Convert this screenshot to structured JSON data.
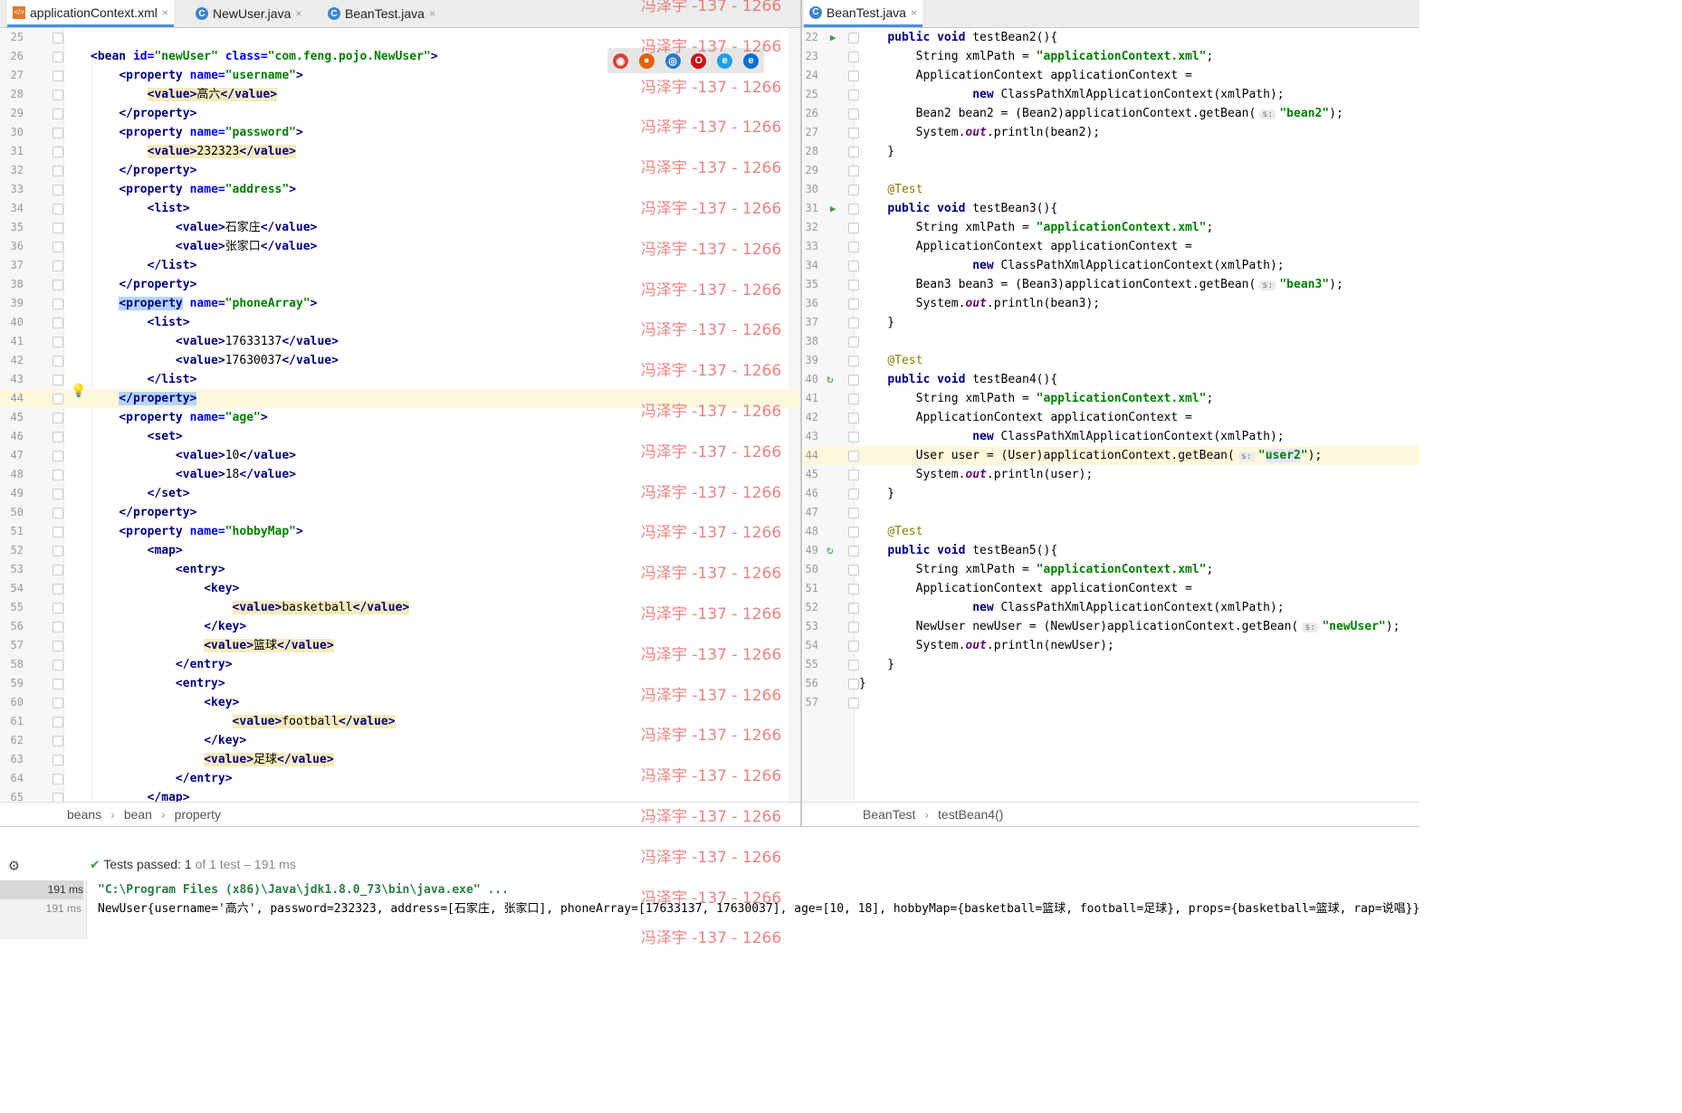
{
  "left_tabs": [
    {
      "label": "applicationContext.xml",
      "icon": "xml-file-icon",
      "active": true
    },
    {
      "label": "NewUser.java",
      "icon": "class-file-icon",
      "active": false
    },
    {
      "label": "BeanTest.java",
      "icon": "test-class-file-icon",
      "active": false
    }
  ],
  "right_tabs": [
    {
      "label": "BeanTest.java",
      "icon": "test-class-file-icon",
      "active": true
    }
  ],
  "close_glyph": "×",
  "watermark": "冯泽宇 -137 - 1266",
  "xml_lines": [
    {
      "n": "25",
      "html": ""
    },
    {
      "n": "26",
      "html": "<span class=\"tag\">&lt;bean </span><span class=\"at\">id=</span><span class=\"av\">\"newUser\"</span> <span class=\"at\">class=</span><span class=\"av\">\"com.feng.pojo.NewUser\"</span><span class=\"tag\">&gt;</span>"
    },
    {
      "n": "27",
      "html": "    <span class=\"tag\">&lt;property </span><span class=\"at\">name=</span><span class=\"av\">\"username\"</span><span class=\"tag\">&gt;</span>"
    },
    {
      "n": "28",
      "html": "        <span class=\"hl\"><span class=\"tag\">&lt;value&gt;</span>高六<span class=\"tag\">&lt;/value&gt;</span></span>"
    },
    {
      "n": "29",
      "html": "    <span class=\"tag\">&lt;/property&gt;</span>"
    },
    {
      "n": "30",
      "html": "    <span class=\"tag\">&lt;property </span><span class=\"at\">name=</span><span class=\"av\">\"password\"</span><span class=\"tag\">&gt;</span>"
    },
    {
      "n": "31",
      "html": "        <span class=\"hl\"><span class=\"tag\">&lt;value&gt;</span>232323<span class=\"tag\">&lt;/value&gt;</span></span>"
    },
    {
      "n": "32",
      "html": "    <span class=\"tag\">&lt;/property&gt;</span>"
    },
    {
      "n": "33",
      "html": "    <span class=\"tag\">&lt;property </span><span class=\"at\">name=</span><span class=\"av\">\"address\"</span><span class=\"tag\">&gt;</span>"
    },
    {
      "n": "34",
      "html": "        <span class=\"tag\">&lt;list&gt;</span>"
    },
    {
      "n": "35",
      "html": "            <span class=\"tag\">&lt;value&gt;</span>石家庄<span class=\"tag\">&lt;/value&gt;</span>"
    },
    {
      "n": "36",
      "html": "            <span class=\"tag\">&lt;value&gt;</span>张家口<span class=\"tag\">&lt;/value&gt;</span>"
    },
    {
      "n": "37",
      "html": "        <span class=\"tag\">&lt;/list&gt;</span>"
    },
    {
      "n": "38",
      "html": "    <span class=\"tag\">&lt;/property&gt;</span>"
    },
    {
      "n": "39",
      "html": "    <span class=\"hlsel\"><span class=\"tag\">&lt;property</span></span> <span class=\"at\">name=</span><span class=\"av\">\"phoneArray\"</span><span class=\"tag\">&gt;</span>"
    },
    {
      "n": "40",
      "html": "        <span class=\"tag\">&lt;list&gt;</span>"
    },
    {
      "n": "41",
      "html": "            <span class=\"tag\">&lt;value&gt;</span>17633137<span class=\"tag\">&lt;/value&gt;</span>"
    },
    {
      "n": "42",
      "html": "            <span class=\"tag\">&lt;value&gt;</span>17630037<span class=\"tag\">&lt;/value&gt;</span>"
    },
    {
      "n": "43",
      "html": "        <span class=\"tag\">&lt;/list&gt;</span>"
    },
    {
      "n": "44",
      "html": "    <span class=\"hlsel\"><span class=\"tag\">&lt;/property&gt;</span></span>",
      "cur": true
    },
    {
      "n": "45",
      "html": "    <span class=\"tag\">&lt;property </span><span class=\"at\">name=</span><span class=\"av\">\"age\"</span><span class=\"tag\">&gt;</span>"
    },
    {
      "n": "46",
      "html": "        <span class=\"tag\">&lt;set&gt;</span>"
    },
    {
      "n": "47",
      "html": "            <span class=\"tag\">&lt;value&gt;</span>10<span class=\"tag\">&lt;/value&gt;</span>"
    },
    {
      "n": "48",
      "html": "            <span class=\"tag\">&lt;value&gt;</span>18<span class=\"tag\">&lt;/value&gt;</span>"
    },
    {
      "n": "49",
      "html": "        <span class=\"tag\">&lt;/set&gt;</span>"
    },
    {
      "n": "50",
      "html": "    <span class=\"tag\">&lt;/property&gt;</span>"
    },
    {
      "n": "51",
      "html": "    <span class=\"tag\">&lt;property </span><span class=\"at\">name=</span><span class=\"av\">\"hobbyMap\"</span><span class=\"tag\">&gt;</span>"
    },
    {
      "n": "52",
      "html": "        <span class=\"tag\">&lt;map&gt;</span>"
    },
    {
      "n": "53",
      "html": "            <span class=\"tag\">&lt;entry&gt;</span>"
    },
    {
      "n": "54",
      "html": "                <span class=\"tag\">&lt;key&gt;</span>"
    },
    {
      "n": "55",
      "html": "                    <span class=\"hl\"><span class=\"tag\">&lt;value&gt;</span>basketball<span class=\"tag\">&lt;/value&gt;</span></span>"
    },
    {
      "n": "56",
      "html": "                <span class=\"tag\">&lt;/key&gt;</span>"
    },
    {
      "n": "57",
      "html": "                <span class=\"hl\"><span class=\"tag\">&lt;value&gt;</span>篮球<span class=\"tag\">&lt;/value&gt;</span></span>"
    },
    {
      "n": "58",
      "html": "            <span class=\"tag\">&lt;/entry&gt;</span>"
    },
    {
      "n": "59",
      "html": "            <span class=\"tag\">&lt;entry&gt;</span>"
    },
    {
      "n": "60",
      "html": "                <span class=\"tag\">&lt;key&gt;</span>"
    },
    {
      "n": "61",
      "html": "                    <span class=\"hl\"><span class=\"tag\">&lt;value&gt;</span>football<span class=\"tag\">&lt;/value&gt;</span></span>"
    },
    {
      "n": "62",
      "html": "                <span class=\"tag\">&lt;/key&gt;</span>"
    },
    {
      "n": "63",
      "html": "                <span class=\"hl\"><span class=\"tag\">&lt;value&gt;</span>足球<span class=\"tag\">&lt;/value&gt;</span></span>"
    },
    {
      "n": "64",
      "html": "            <span class=\"tag\">&lt;/entry&gt;</span>"
    },
    {
      "n": "65",
      "html": "        <span class=\"tag\">&lt;/map&gt;</span>"
    }
  ],
  "java_lines": [
    {
      "n": "22",
      "html": "    <span class=\"kw\">public void</span> testBean2(){",
      "run": true
    },
    {
      "n": "23",
      "html": "        String xmlPath = <span class=\"str\">\"applicationContext.xml\"</span>;"
    },
    {
      "n": "24",
      "html": "        ApplicationContext applicationContext ="
    },
    {
      "n": "25",
      "html": "                <span class=\"kw\">new</span> ClassPathXmlApplicationContext(xmlPath);"
    },
    {
      "n": "26",
      "html": "        Bean2 bean2 = (Bean2)applicationContext.getBean(<span class=\"hint\">s:</span><span class=\"str\">\"bean2\"</span>);"
    },
    {
      "n": "27",
      "html": "        System.<span class=\"st\">out</span>.println(bean2);"
    },
    {
      "n": "28",
      "html": "    }"
    },
    {
      "n": "29",
      "html": ""
    },
    {
      "n": "30",
      "html": "    <span class=\"ann\">@Test</span>"
    },
    {
      "n": "31",
      "html": "    <span class=\"kw\">public void</span> testBean3(){",
      "run": true
    },
    {
      "n": "32",
      "html": "        String xmlPath = <span class=\"str\">\"applicationContext.xml\"</span>;"
    },
    {
      "n": "33",
      "html": "        ApplicationContext applicationContext ="
    },
    {
      "n": "34",
      "html": "                <span class=\"kw\">new</span> ClassPathXmlApplicationContext(xmlPath);"
    },
    {
      "n": "35",
      "html": "        Bean3 bean3 = (Bean3)applicationContext.getBean(<span class=\"hint\">s:</span><span class=\"str\">\"bean3\"</span>);"
    },
    {
      "n": "36",
      "html": "        System.<span class=\"st\">out</span>.println(bean3);"
    },
    {
      "n": "37",
      "html": "    }"
    },
    {
      "n": "38",
      "html": ""
    },
    {
      "n": "39",
      "html": "    <span class=\"ann\">@Test</span>"
    },
    {
      "n": "40",
      "html": "    <span class=\"kw\">public void</span> testBean4(){",
      "rerun": true
    },
    {
      "n": "41",
      "html": "        String xmlPath = <span class=\"str\">\"applicationContext.xml\"</span>;"
    },
    {
      "n": "42",
      "html": "        ApplicationContext applicationContext ="
    },
    {
      "n": "43",
      "html": "                <span class=\"kw\">new</span> ClassPathXmlApplicationContext(xmlPath);"
    },
    {
      "n": "44",
      "html": "        User user = (User)applicationContext.getBean(<span class=\"hint\">s:</span><span class=\"str\">\"<span class=\"hlu\">user2</span>\"</span>);",
      "cur": true
    },
    {
      "n": "45",
      "html": "        System.<span class=\"st\">out</span>.println(user);"
    },
    {
      "n": "46",
      "html": "    }"
    },
    {
      "n": "47",
      "html": ""
    },
    {
      "n": "48",
      "html": "    <span class=\"ann\">@Test</span>"
    },
    {
      "n": "49",
      "html": "    <span class=\"kw\">public void</span> testBean5(){",
      "rerun": true
    },
    {
      "n": "50",
      "html": "        String xmlPath = <span class=\"str\">\"applicationContext.xml\"</span>;"
    },
    {
      "n": "51",
      "html": "        ApplicationContext applicationContext ="
    },
    {
      "n": "52",
      "html": "                <span class=\"kw\">new</span> ClassPathXmlApplicationContext(xmlPath);"
    },
    {
      "n": "53",
      "html": "        NewUser newUser = (NewUser)applicationContext.getBean(<span class=\"hint\">s:</span><span class=\"str\">\"newUser\"</span>);"
    },
    {
      "n": "54",
      "html": "        System.<span class=\"st\">out</span>.println(newUser);"
    },
    {
      "n": "55",
      "html": "    }"
    },
    {
      "n": "56",
      "html": "}"
    },
    {
      "n": "57",
      "html": ""
    }
  ],
  "left_breadcrumb": [
    "beans",
    "bean",
    "property"
  ],
  "right_breadcrumb": [
    "BeanTest",
    "testBean4()"
  ],
  "breadcrumb_sep": "›",
  "tests": {
    "label": "Tests passed:",
    "passed": "1",
    "rest": "of 1 test – 191 ms"
  },
  "output": [
    {
      "time": "191 ms",
      "text": "\"C:\\Program Files (x86)\\Java\\jdk1.8.0_73\\bin\\java.exe\" ..."
    },
    {
      "time": "191 ms",
      "text": "NewUser{username='高六', password=232323, address=[石家庄, 张家口], phoneArray=[17633137, 17630037], age=[10, 18], hobbyMap={basketball=篮球, football=足球}, props={basketball=篮球, rap=说唱}}"
    }
  ],
  "browser_icons": [
    "chrome-icon",
    "firefox-icon",
    "safari-icon",
    "opera-icon",
    "ie-icon",
    "edge-icon"
  ]
}
